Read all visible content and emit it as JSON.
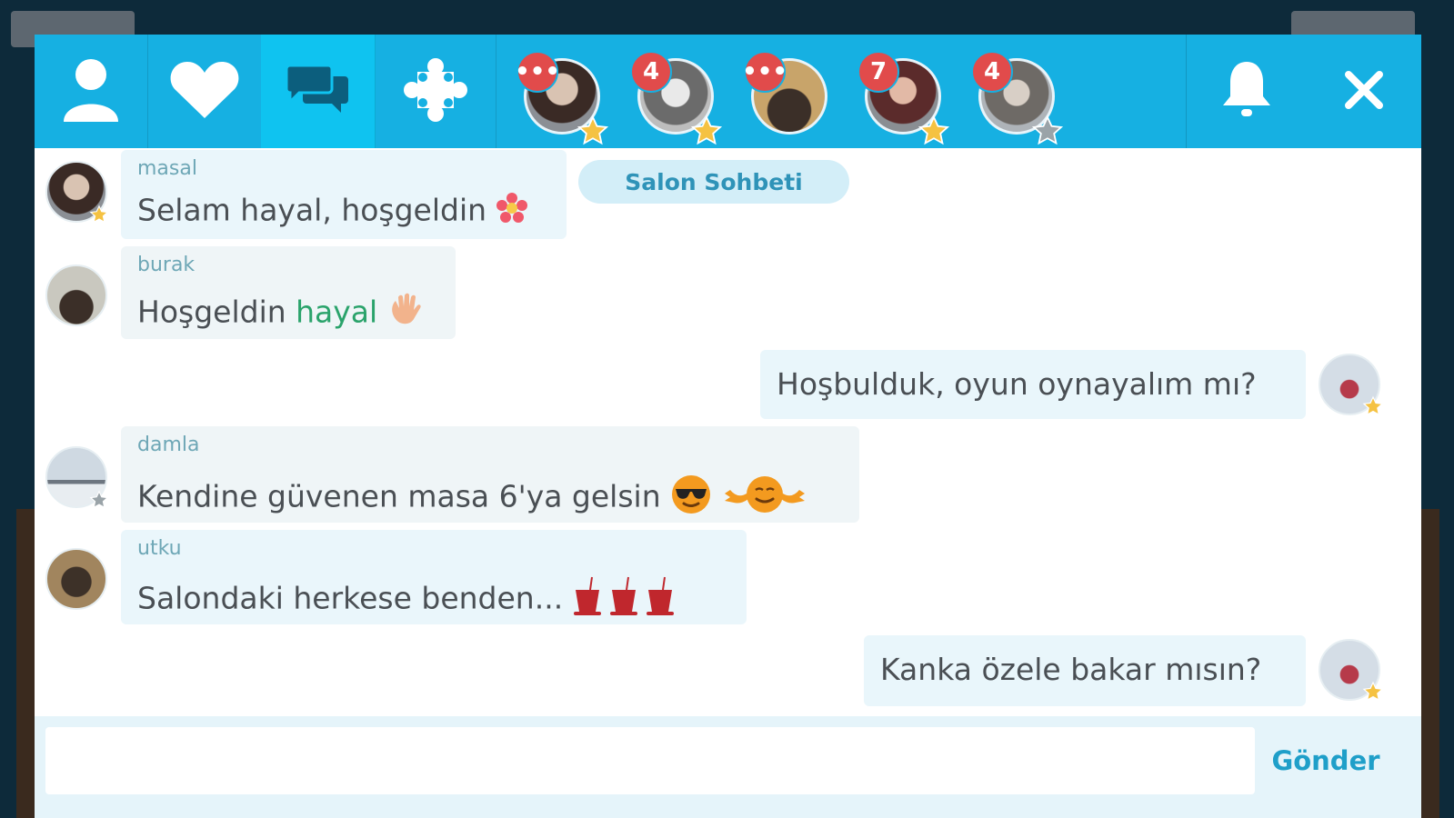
{
  "toolbar": {
    "tabs": [
      {
        "icon": "user-icon"
      },
      {
        "icon": "heart-icon"
      },
      {
        "icon": "chat-bubbles-icon",
        "active": true
      },
      {
        "icon": "puzzle-icon"
      }
    ],
    "notifications_icon": "bell-icon",
    "close_icon": "close-icon"
  },
  "conversations": [
    {
      "badge": "•••",
      "star": "gold"
    },
    {
      "badge": "4",
      "star": "gold"
    },
    {
      "badge": "•••",
      "star": "none"
    },
    {
      "badge": "7",
      "star": "gold"
    },
    {
      "badge": "4",
      "star": "gray"
    }
  ],
  "room_label": "Salon Sohbeti",
  "messages": [
    {
      "user": "masal",
      "text": "Selam hayal, hoşgeldin",
      "emoji": "flower-emoji"
    },
    {
      "user": "burak",
      "text": "Hoşgeldin ",
      "highlight": "hayal",
      "emoji": "wave-emoji"
    },
    {
      "user": "",
      "text": "Hoşbulduk, oyun oynayalım mı?",
      "own": true
    },
    {
      "user": "damla",
      "text": "Kendine güvenen masa 6'ya gelsin",
      "emoji": "sunglasses-emoji, flexing-emoji"
    },
    {
      "user": "utku",
      "text": "Salondaki herkese benden...",
      "emoji": "tea-glass-emoji x3"
    },
    {
      "user": "",
      "text": "Kanka özele bakar mısın?",
      "own": true
    }
  ],
  "composer": {
    "placeholder": "",
    "send_label": "Gönder"
  },
  "colors": {
    "topbar": "#16b0e2",
    "active_tab": "#0fc3f0",
    "badge": "#e14b4b",
    "bubble": "#eaf6fb",
    "username": "#6ea7b6",
    "mention": "#2aa36b",
    "send": "#1f9fc9"
  }
}
